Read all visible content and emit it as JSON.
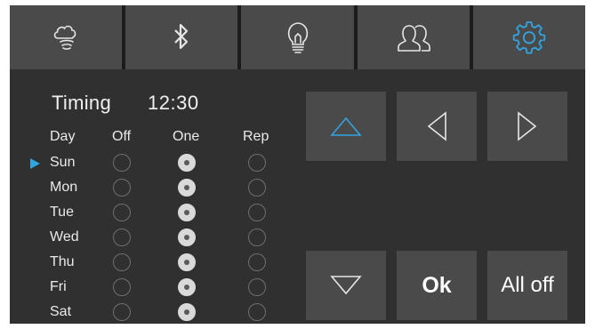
{
  "tabs": [
    {
      "name": "weather-cloud-icon",
      "active": false
    },
    {
      "name": "bluetooth-icon",
      "active": false
    },
    {
      "name": "light-bulb-icon",
      "active": false
    },
    {
      "name": "users-icon",
      "active": false
    },
    {
      "name": "settings-gear-icon",
      "active": true
    }
  ],
  "timing": {
    "title": "Timing",
    "time": "12:30",
    "columns": {
      "day": "Day",
      "off": "Off",
      "one": "One",
      "rep": "Rep"
    },
    "selected_day": "Sun",
    "days": [
      {
        "label": "Sun",
        "mode": "One"
      },
      {
        "label": "Mon",
        "mode": "One"
      },
      {
        "label": "Tue",
        "mode": "One"
      },
      {
        "label": "Wed",
        "mode": "One"
      },
      {
        "label": "Thu",
        "mode": "One"
      },
      {
        "label": "Fri",
        "mode": "One"
      },
      {
        "label": "Sat",
        "mode": "One"
      }
    ]
  },
  "controls": {
    "up_icon": "arrow-up-icon",
    "left_icon": "arrow-left-icon",
    "right_icon": "arrow-right-icon",
    "down_icon": "arrow-down-icon",
    "ok_label": "Ok",
    "all_off_label": "All off"
  },
  "colors": {
    "accent": "#33a4e0",
    "background": "#303030",
    "button": "#4a4a4a",
    "text": "#eaeaea"
  }
}
